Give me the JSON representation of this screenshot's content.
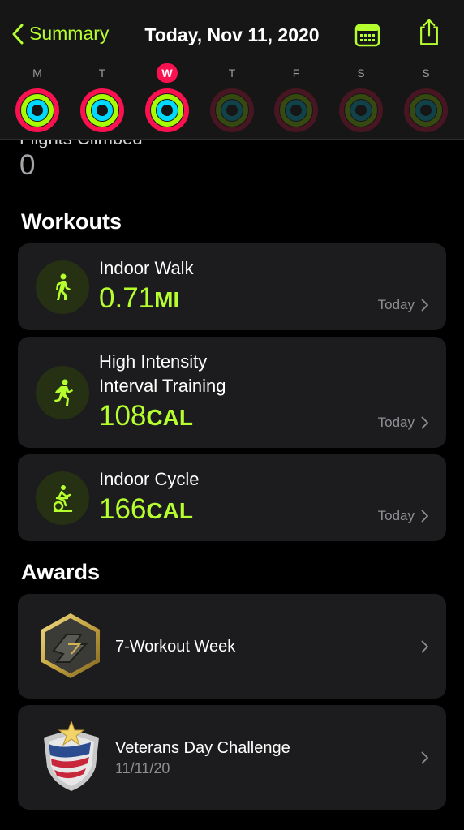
{
  "header": {
    "back_label": "Summary",
    "title": "Today, Nov 11, 2020",
    "calendar_icon": "calendar-icon",
    "share_icon": "share-icon",
    "accent": "#b6ff2f"
  },
  "week": [
    {
      "letter": "M",
      "active": false,
      "dim": false
    },
    {
      "letter": "T",
      "active": false,
      "dim": false
    },
    {
      "letter": "W",
      "active": true,
      "dim": false
    },
    {
      "letter": "T",
      "active": false,
      "dim": true
    },
    {
      "letter": "F",
      "active": false,
      "dim": true
    },
    {
      "letter": "S",
      "active": false,
      "dim": true
    },
    {
      "letter": "S",
      "active": false,
      "dim": true
    }
  ],
  "flights": {
    "label": "Flights Climbed",
    "value": "0"
  },
  "workouts": {
    "title": "Workouts",
    "items": [
      {
        "name": "Indoor Walk",
        "value": "0.71",
        "unit": "MI",
        "date": "Today",
        "icon": "walk-icon"
      },
      {
        "name_line1": "High Intensity",
        "name_line2": "Interval Training",
        "value": "108",
        "unit": "CAL",
        "date": "Today",
        "icon": "hiit-icon"
      },
      {
        "name": "Indoor Cycle",
        "value": "166",
        "unit": "CAL",
        "date": "Today",
        "icon": "cycle-icon"
      }
    ]
  },
  "awards": {
    "title": "Awards",
    "items": [
      {
        "name": "7-Workout Week",
        "icon": "hexagon-award-icon"
      },
      {
        "name": "Veterans Day Challenge",
        "date": "11/11/20",
        "icon": "shield-award-icon"
      }
    ]
  },
  "colors": {
    "move": "#fa114f",
    "exercise": "#a6ff00",
    "stand": "#00d9ff"
  }
}
